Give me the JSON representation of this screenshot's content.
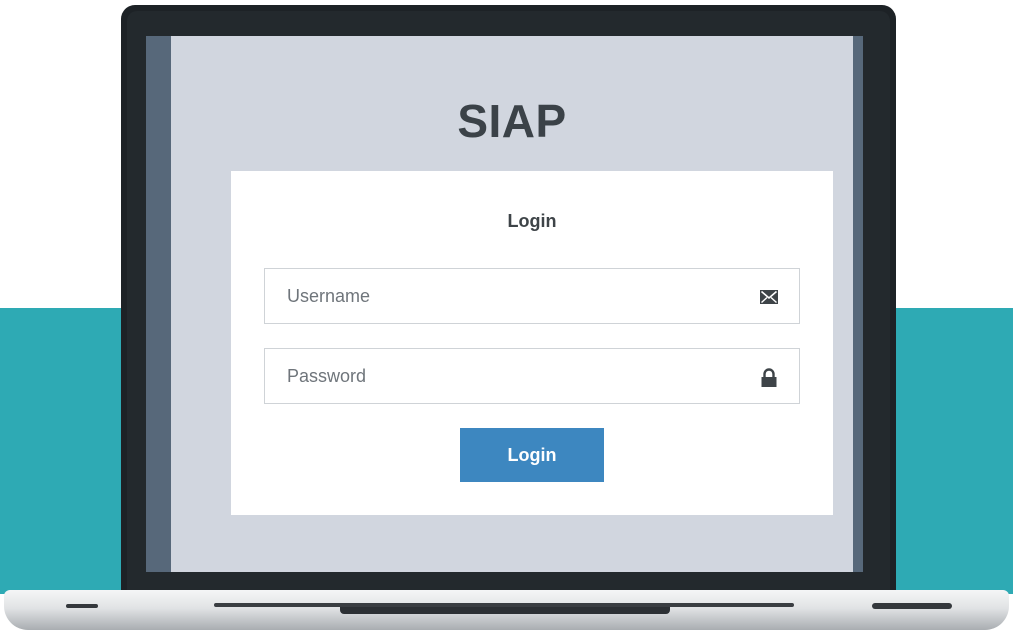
{
  "app": {
    "title": "SIAP"
  },
  "login_form": {
    "heading": "Login",
    "username": {
      "placeholder": "Username",
      "value": "",
      "icon": "envelope-icon"
    },
    "password": {
      "placeholder": "Password",
      "value": "",
      "icon": "lock-icon"
    },
    "submit_label": "Login"
  },
  "colors": {
    "accent_teal": "#2eaab4",
    "button_blue": "#3d87c0",
    "screen_bg": "#d1d6df",
    "laptop_frame": "#1d2226"
  }
}
